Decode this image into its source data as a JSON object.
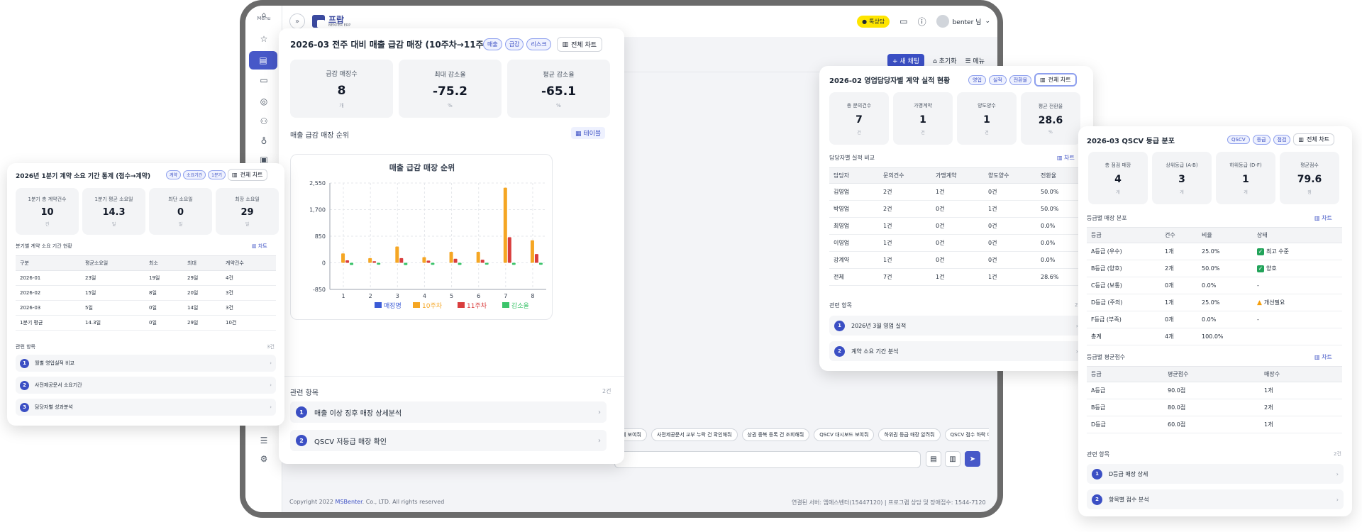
{
  "app": {
    "menu_label": "Menu",
    "logo_name": "프랍",
    "logo_sub": "BENTER ERP",
    "kakao_label": "톡상담",
    "user_name": "benter 님"
  },
  "chatbar": {
    "new_chat": "+ 새 채팅",
    "reset": "초기화",
    "menu": "메뉴"
  },
  "chips": [
    "계 보여줘",
    "사전제공문서 교부 누락 건 확인해줘",
    "상권 중복 등록 건 조회해줘",
    "QSCV 대시보드 보여줘",
    "하위권 등급 매장 알려줘",
    "QSCV 점수 하락 매"
  ],
  "footer": {
    "copyright_pre": "Copyright 2022 ",
    "copyright_link": "MSBenter",
    "copyright_post": ". Co., LTD. All rights reserved",
    "right": "연결된 서버: 엠에스벤터(15447120) | 프로그램 상담 및 장애접수: 1544-7120"
  },
  "card_sales": {
    "title": "2026-03 전주 대비 매출 급감 매장 (10주차→11주차)",
    "tags": [
      "매출",
      "급감",
      "리스크"
    ],
    "full_chart": "전체 차트",
    "stats": [
      {
        "label": "급감 매장수",
        "value": "8",
        "unit": "개"
      },
      {
        "label": "최대 감소율",
        "value": "-75.2",
        "unit": "%"
      },
      {
        "label": "평균 감소율",
        "value": "-65.1",
        "unit": "%"
      }
    ],
    "section": "매출 급감 매장 순위",
    "table_btn": "테이블",
    "related_label": "관련 항목",
    "related_count": "2건",
    "related": [
      "매출 이상 징후 매장 상세분석",
      "QSCV 저등급 매장 확인"
    ]
  },
  "chart_data": {
    "type": "bar",
    "title": "매출 급감 매장 순위",
    "categories": [
      "1",
      "2",
      "3",
      "4",
      "5",
      "6",
      "7",
      "8"
    ],
    "yticks": [
      "2,550",
      "1,700",
      "850",
      "0",
      "-850"
    ],
    "ylim": [
      -850,
      2550
    ],
    "series": [
      {
        "name": "매장명",
        "color": "#3b5bd6",
        "values": [
          0,
          0,
          0,
          0,
          0,
          0,
          0,
          0
        ]
      },
      {
        "name": "10주차",
        "color": "#f5a623",
        "values": [
          300,
          150,
          520,
          180,
          350,
          350,
          2400,
          720
        ]
      },
      {
        "name": "11주차",
        "color": "#d93d3d",
        "values": [
          80,
          50,
          150,
          70,
          130,
          100,
          820,
          280
        ]
      },
      {
        "name": "감소율",
        "color": "#3cc46b",
        "values": [
          -70,
          -60,
          -75,
          -65,
          -68,
          -60,
          -66,
          -62
        ]
      }
    ]
  },
  "card_contract": {
    "title": "2026년 1분기 계약 소요 기간 통계 (접수→계약)",
    "tags": [
      "계약",
      "소요기간",
      "1분기"
    ],
    "full_chart": "전체 차트",
    "stats": [
      {
        "label": "1분기 총 계약건수",
        "value": "10",
        "unit": "건"
      },
      {
        "label": "1분기 평균 소요일",
        "value": "14.3",
        "unit": "일"
      },
      {
        "label": "최단 소요일",
        "value": "0",
        "unit": "일"
      },
      {
        "label": "최장 소요일",
        "value": "29",
        "unit": "일"
      }
    ],
    "section": "분기별 계약 소요 기간 현황",
    "chart_link": "차트",
    "columns": [
      "구분",
      "평균소요일",
      "최소",
      "최대",
      "계약건수"
    ],
    "rows": [
      [
        "2026-01",
        "23일",
        "19일",
        "29일",
        "4건"
      ],
      [
        "2026-02",
        "15일",
        "8일",
        "20일",
        "3건"
      ],
      [
        "2026-03",
        "5일",
        "0일",
        "14일",
        "3건"
      ],
      [
        "1분기 평균",
        "14.3일",
        "0일",
        "29일",
        "10건"
      ]
    ],
    "related_label": "관련 항목",
    "related_count": "3건",
    "related": [
      "월별 영업실적 비교",
      "사전제공문서 소요기간",
      "담당자별 성과분석"
    ]
  },
  "card_sales_rep": {
    "title": "2026-02 영업담당자별 계약 실적 현황",
    "tags": [
      "영업",
      "실적",
      "전환율"
    ],
    "full_chart": "전체 차트",
    "stats": [
      {
        "label": "총 문의건수",
        "value": "7",
        "unit": "건"
      },
      {
        "label": "가맹계약",
        "value": "1",
        "unit": "건"
      },
      {
        "label": "양도양수",
        "value": "1",
        "unit": "건"
      },
      {
        "label": "평균 전환율",
        "value": "28.6",
        "unit": "%"
      }
    ],
    "section": "담당자별 실적 비교",
    "chart_link": "차트",
    "columns": [
      "담당자",
      "문의건수",
      "가맹계약",
      "양도양수",
      "전환율"
    ],
    "rows": [
      [
        "김영업",
        "2건",
        "1건",
        "0건",
        "50.0%"
      ],
      [
        "박영업",
        "2건",
        "0건",
        "1건",
        "50.0%"
      ],
      [
        "최영업",
        "1건",
        "0건",
        "0건",
        "0.0%"
      ],
      [
        "이영업",
        "1건",
        "0건",
        "0건",
        "0.0%"
      ],
      [
        "강계약",
        "1건",
        "0건",
        "0건",
        "0.0%"
      ],
      [
        "전체",
        "7건",
        "1건",
        "1건",
        "28.6%"
      ]
    ],
    "related_label": "관련 항목",
    "related_count": "2건",
    "related": [
      "2026년 3월 영업 실적",
      "계약 소요 기간 분석"
    ]
  },
  "card_qscv": {
    "title": "2026-03 QSCV 등급 분포",
    "tags": [
      "QSCV",
      "등급",
      "점검"
    ],
    "full_chart": "전체 차트",
    "stats": [
      {
        "label": "총 점검 매장",
        "value": "4",
        "unit": "개"
      },
      {
        "label": "상위등급 (A-B)",
        "value": "3",
        "unit": "개"
      },
      {
        "label": "하위등급 (D-F)",
        "value": "1",
        "unit": "개"
      },
      {
        "label": "평균점수",
        "value": "79.6",
        "unit": "점"
      }
    ],
    "section1": "등급별 매장 분포",
    "chart_link1": "차트",
    "columns1": [
      "등급",
      "건수",
      "비율",
      "상태"
    ],
    "rows1": [
      [
        "A등급 (우수)",
        "1개",
        "25.0%",
        "최고 수준",
        "ok"
      ],
      [
        "B등급 (양호)",
        "2개",
        "50.0%",
        "양호",
        "ok"
      ],
      [
        "C등급 (보통)",
        "0개",
        "0.0%",
        "-",
        ""
      ],
      [
        "D등급 (주의)",
        "1개",
        "25.0%",
        "개선필요",
        "warn"
      ],
      [
        "F등급 (부족)",
        "0개",
        "0.0%",
        "-",
        ""
      ],
      [
        "총계",
        "4개",
        "100.0%",
        "",
        ""
      ]
    ],
    "section2": "등급별 평균점수",
    "chart_link2": "차트",
    "columns2": [
      "등급",
      "평균점수",
      "매장수"
    ],
    "rows2": [
      [
        "A등급",
        "90.0점",
        "1개"
      ],
      [
        "B등급",
        "80.0점",
        "2개"
      ],
      [
        "D등급",
        "60.0점",
        "1개"
      ]
    ],
    "related_label": "관련 항목",
    "related_count": "2건",
    "related": [
      "D등급 매장 상세",
      "항목별 점수 분석"
    ]
  }
}
